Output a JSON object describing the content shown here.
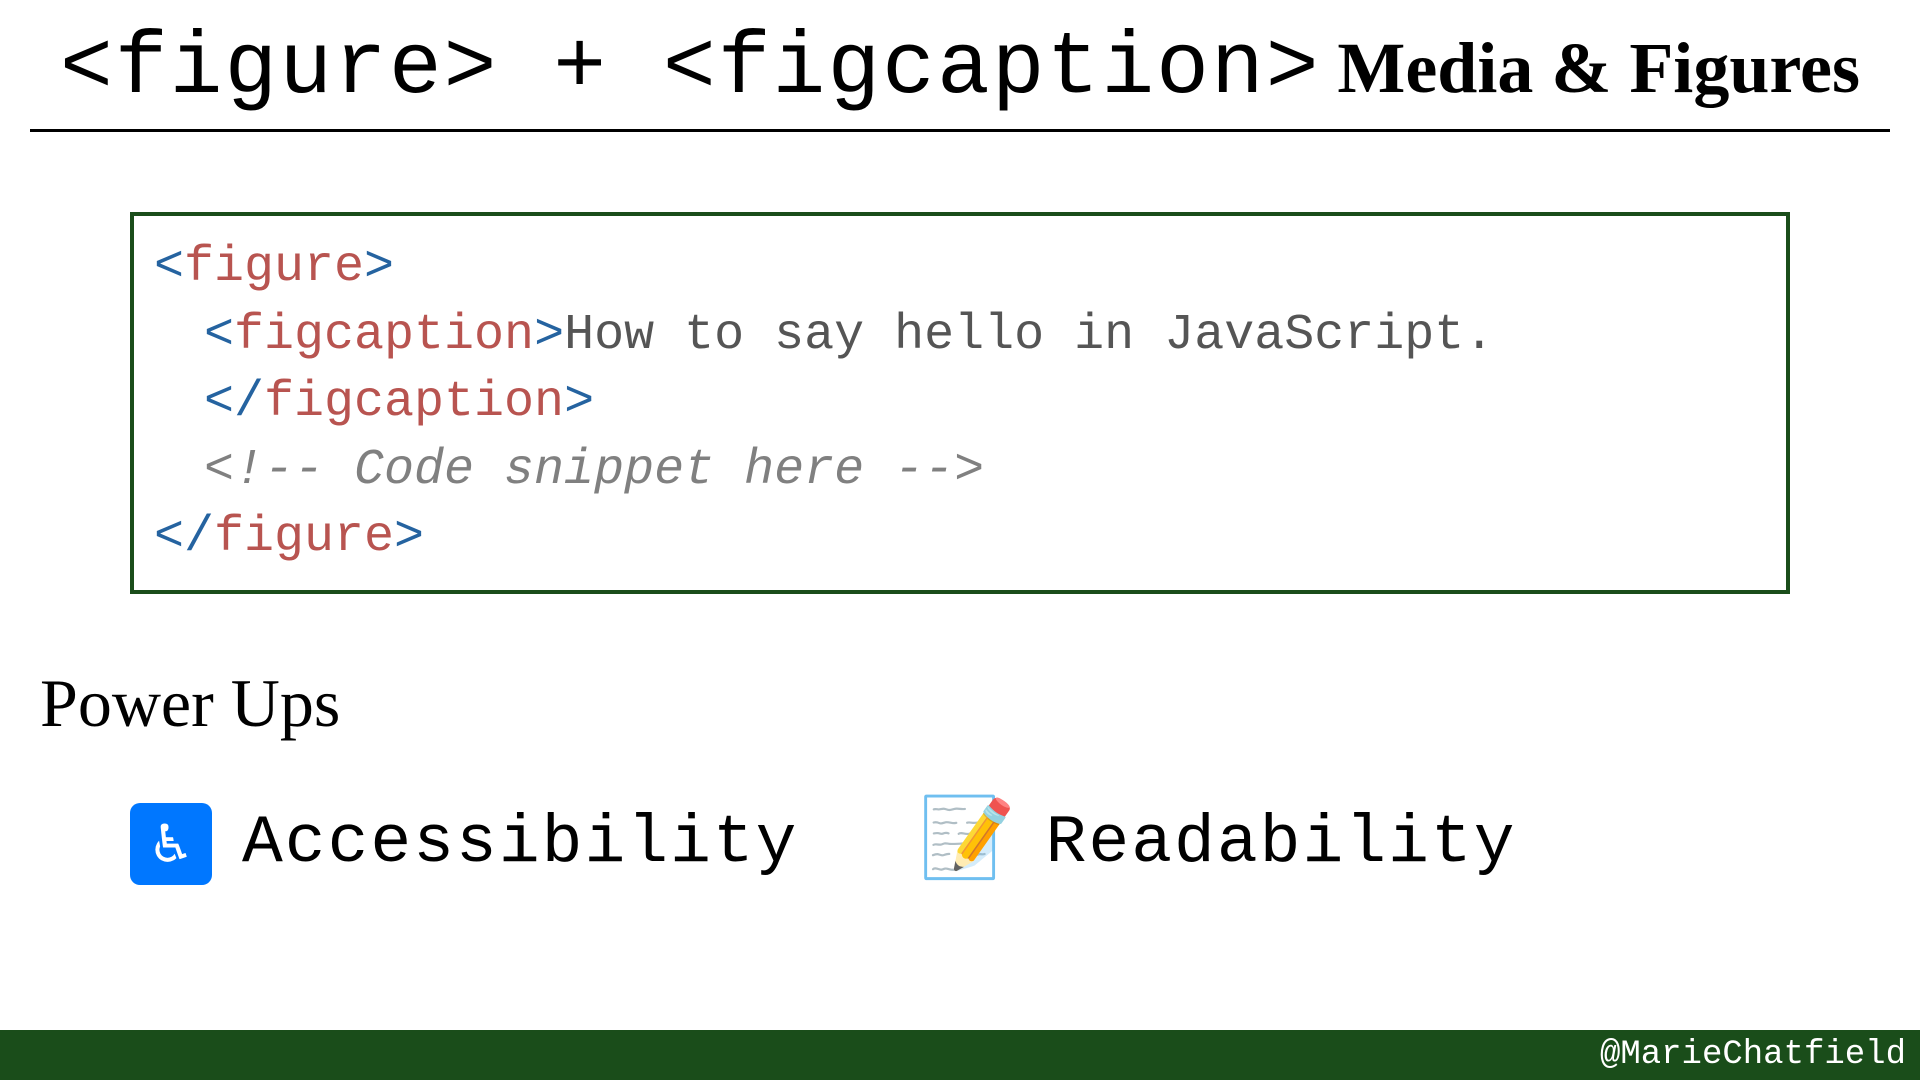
{
  "header": {
    "title": "<figure> + <figcaption>",
    "subtitle": "Media & Figures"
  },
  "code": {
    "line1_open_punct": "<",
    "line1_open_tag": "figure",
    "line1_close_punct": ">",
    "line2_open_punct": "<",
    "line2_open_tag": "figcaption",
    "line2_mid_punct": ">",
    "line2_text": "How to say hello in JavaScript.",
    "line2_close_punct1": "</",
    "line2_close_tag": "figcaption",
    "line2_close_punct2": ">",
    "line3_comment": "<!-- Code snippet here -->",
    "line4_open_punct": "</",
    "line4_tag": "figure",
    "line4_close_punct": ">"
  },
  "powerups": {
    "label": "Power Ups",
    "items": [
      {
        "icon": "♿",
        "label": "Accessibility"
      },
      {
        "icon": "📝",
        "label": "Readability"
      }
    ]
  },
  "footer": {
    "handle": "@MarieChatfield"
  }
}
